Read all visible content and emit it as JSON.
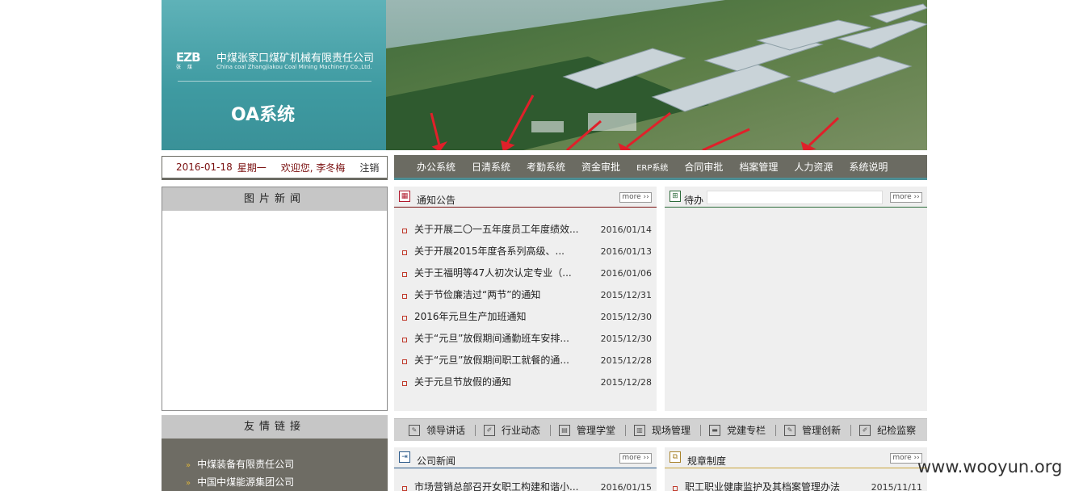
{
  "brand": {
    "logo_text": "EZB",
    "logo_sub": "张 煤",
    "company_cn": "中煤张家口煤矿机械有限责任公司",
    "company_en": "China coal Zhangjiakou Coal Mining Machinery Co.,Ltd.",
    "system_title": "OA系统"
  },
  "datebar": {
    "date": "2016-01-18",
    "weekday": "星期一",
    "greeting": "欢迎您, 李冬梅",
    "logout": "注销"
  },
  "nav": {
    "items": [
      "办公系统",
      "日清系统",
      "考勤系统",
      "资金审批",
      "ERP系统",
      "合同审批",
      "档案管理",
      "人力资源",
      "系统说明"
    ]
  },
  "photo_news": {
    "title": "图片新闻"
  },
  "notice": {
    "title": "通知公告",
    "more": "more ››",
    "items": [
      {
        "title": "关于开展二〇一五年度员工年度绩效...",
        "date": "2016/01/14"
      },
      {
        "title": "关于开展2015年度各系列高级、...",
        "date": "2016/01/13"
      },
      {
        "title": "关于王福明等47人初次认定专业（...",
        "date": "2016/01/06"
      },
      {
        "title": "关于节俭廉洁过“两节”的通知",
        "date": "2015/12/31"
      },
      {
        "title": "2016年元旦生产加班通知",
        "date": "2015/12/30"
      },
      {
        "title": "关于“元旦”放假期间通勤班车安排...",
        "date": "2015/12/30"
      },
      {
        "title": "关于“元旦”放假期间职工就餐的通...",
        "date": "2015/12/28"
      },
      {
        "title": "关于元旦节放假的通知",
        "date": "2015/12/28"
      }
    ]
  },
  "todo": {
    "title": "待办",
    "more": "more ››"
  },
  "friend_links": {
    "title": "友情链接",
    "items": [
      "中煤装备有限责任公司",
      "中国中煤能源集团公司"
    ]
  },
  "toolbar": {
    "items": [
      "领导讲话",
      "行业动态",
      "管理学堂",
      "现场管理",
      "党建专栏",
      "管理创新",
      "纪检监察"
    ]
  },
  "company_news": {
    "title": "公司新闻",
    "more": "more ››",
    "items": [
      {
        "title": "市场营销总部召开女职工构建和谐小...",
        "date": "2016/01/15"
      }
    ]
  },
  "rules": {
    "title": "规章制度",
    "more": "more ››",
    "items": [
      {
        "title": "职工职业健康监护及其档案管理办法",
        "date": "2015/11/11"
      }
    ]
  },
  "watermark": "www.wooyun.org",
  "colors": {
    "teal": "#3e9aa1",
    "nav_bg": "#6b6b62",
    "accent_red": "#7a1010",
    "arrow_red": "#e0202a"
  }
}
